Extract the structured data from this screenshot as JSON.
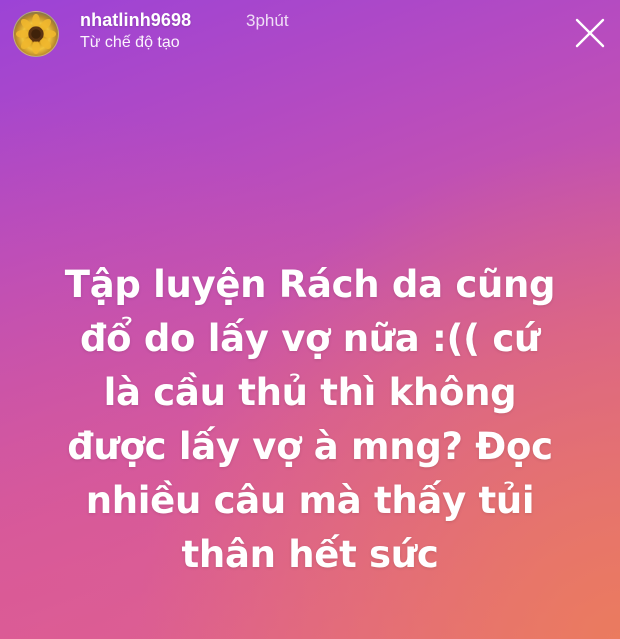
{
  "header": {
    "username": "nhatlinh9698",
    "time": "3phút",
    "subtitle": "Từ chế độ tạo",
    "avatar_icon": "sunflower-avatar",
    "close_icon": "close-icon"
  },
  "caption": {
    "lines": [
      "Tập luyện Rách da cũng",
      "đổ do lấy vợ nữa :(( cứ",
      "là cầu thủ thì không",
      "được lấy vợ à mng? Đọc",
      "nhiều câu mà thấy tủi",
      "thân hết sức"
    ]
  },
  "colors": {
    "gradient_top": "#9c43d6",
    "gradient_mid": "#d35a9c",
    "gradient_bottom": "#e46a83",
    "text": "#ffffff"
  }
}
